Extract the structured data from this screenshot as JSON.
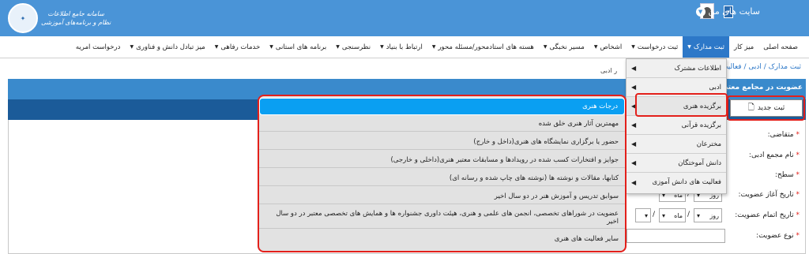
{
  "header": {
    "logo_text": "سامانه جامع اطلاعات",
    "logo_subtext": "نظام و برنامه‌های آموزشی",
    "sites_label": "سایت های من",
    "sites_icon": "chevron-down-icon",
    "user_icon": "user-avatar-icon",
    "brand_color": "#4a94d7"
  },
  "nav": {
    "items": [
      {
        "label": "صفحه اصلی",
        "has_caret": false
      },
      {
        "label": "میز کار",
        "has_caret": false
      },
      {
        "label": "ثبت مدارک",
        "has_caret": true,
        "active": true
      },
      {
        "label": "ثبت درخواست",
        "has_caret": true
      },
      {
        "label": "اشخاص",
        "has_caret": true
      },
      {
        "label": "مسیر نخبگی",
        "has_caret": true
      },
      {
        "label": "هسته های استادمحور/مسئله محور",
        "has_caret": true
      },
      {
        "label": "ارتباط با بنیاد",
        "has_caret": true
      },
      {
        "label": "نظرسنجی",
        "has_caret": true
      },
      {
        "label": "برنامه های استانی",
        "has_caret": true
      },
      {
        "label": "خدمات رفاهی",
        "has_caret": true
      },
      {
        "label": "میز تبادل دانش و فناوری",
        "has_caret": true
      },
      {
        "label": "درخواست امریه",
        "has_caret": false
      }
    ]
  },
  "breadcrumb": {
    "text": "ثبت مدارک / ادبی / فعالیت",
    "sub_text": "ر ادبی"
  },
  "panel": {
    "title": "عضویت در مجامع معتبر ا",
    "new_button": "ثبت جدید"
  },
  "form": {
    "labels": [
      "متقاضی:",
      "نام مجمع ادبی:",
      "سطح:",
      "تاریخ آغاز عضویت:",
      "تاریخ اتمام عضویت:",
      "نوع عضویت:"
    ],
    "day_placeholder": "روز",
    "month_placeholder": "ماه",
    "date_sep": "/"
  },
  "side_menu": {
    "items": [
      {
        "label": "اطلاعات مشترک"
      },
      {
        "label": "ادبی"
      },
      {
        "label": "برگزیده هنری"
      },
      {
        "label": "برگزیده قرآنی"
      },
      {
        "label": "مخترعان"
      },
      {
        "label": "دانش آموختگان"
      },
      {
        "label": "فعالیت های دانش آموزی"
      }
    ]
  },
  "sub_menu": {
    "items": [
      {
        "label": "درجات هنری",
        "active": true
      },
      {
        "label": "مهمترین آثار هنری خلق شده"
      },
      {
        "label": "حضور یا برگزاری نمایشگاه های هنری(داخل و خارج)"
      },
      {
        "label": "جوایز و افتخارات کسب شده در رویدادها و مسابقات معتبر هنری(داخلی و خارجی)"
      },
      {
        "label": "کتابها، مقالات و نوشته ها (نوشته های چاپ شده و رسانه ای)"
      },
      {
        "label": "سوابق تدریس و آموزش هنر در دو سال اخیر"
      },
      {
        "label": "عضویت در شوراهای تخصصی، انجمن های علمی و هنری، هیئت داوری جشنواره ها و همایش های تخصصی معتبر در دو سال اخیر"
      },
      {
        "label": "سایر فعالیت های هنری"
      }
    ]
  },
  "colors": {
    "highlight_red": "#e3201b",
    "active_blue": "#0a9ff2",
    "nav_active": "#2d78c8"
  }
}
